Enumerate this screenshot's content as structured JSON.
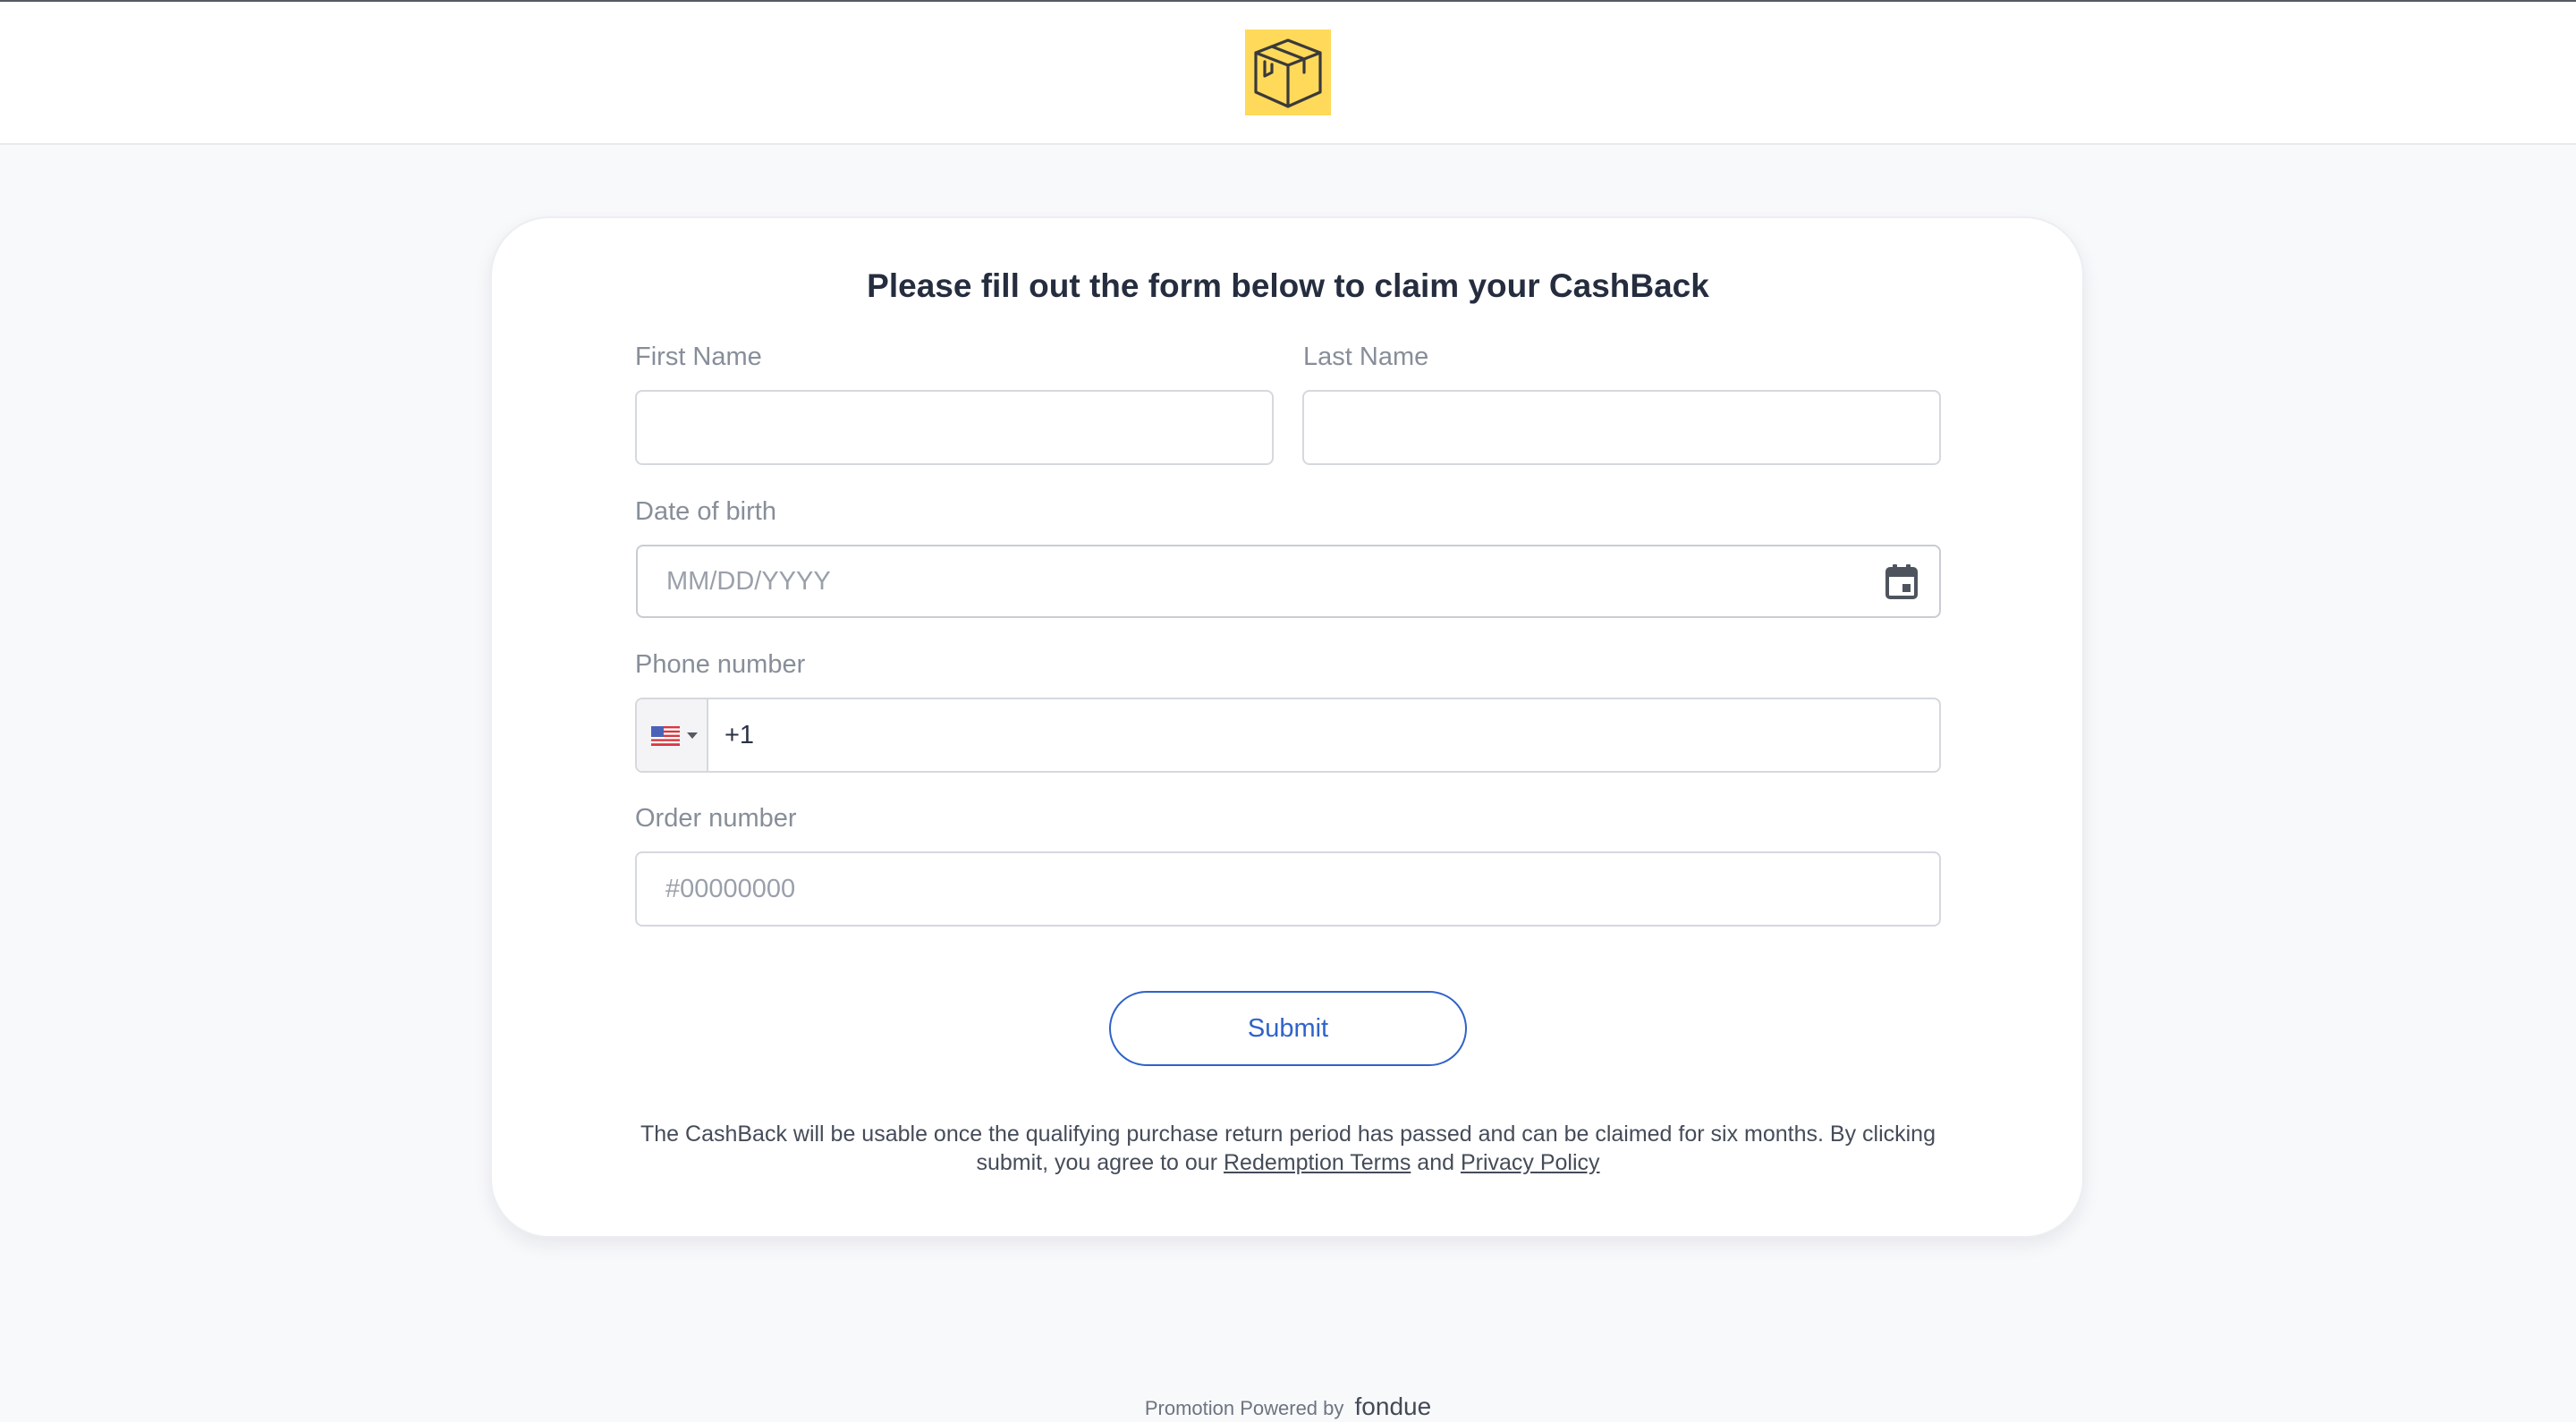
{
  "colors": {
    "background": "#f8f9fb",
    "logo_background": "#ffd95a",
    "accent": "#2f63c9",
    "title_text": "#252d3f",
    "label_text": "#878e99"
  },
  "header": {
    "logo_icon": "package-box-icon"
  },
  "form": {
    "title": "Please fill out the form below to claim your CashBack",
    "first_name": {
      "label": "First Name",
      "value": ""
    },
    "last_name": {
      "label": "Last Name",
      "value": ""
    },
    "date_of_birth": {
      "label": "Date of birth",
      "placeholder": "MM/DD/YYYY",
      "icon": "calendar-icon"
    },
    "phone": {
      "label": "Phone number",
      "country_flag": "us-flag-icon",
      "value": "+1"
    },
    "order_number": {
      "label": "Order number",
      "placeholder": "#00000000"
    },
    "submit_label": "Submit"
  },
  "terms": {
    "text_before": "The CashBack will be usable once the qualifying purchase return period has passed and can be claimed for six months. By clicking submit, you agree to our ",
    "redemption_link": "Redemption Terms",
    "and_text": " and ",
    "privacy_link": "Privacy Policy"
  },
  "footer": {
    "text": "Promotion Powered by",
    "brand": "fondue"
  }
}
